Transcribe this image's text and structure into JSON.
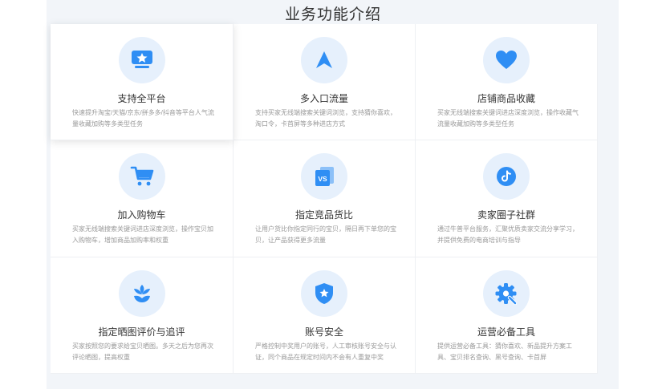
{
  "section": {
    "title": "业务功能介绍"
  },
  "features": [
    {
      "title": "支持全平台",
      "desc": "快速提升淘宝/天猫/京东/拼多多/抖音等平台人气流量收藏加购等多类型任务",
      "icon": "star-screen-icon"
    },
    {
      "title": "多入口流量",
      "desc": "支持买家无线端搜索关键词浏览，支持猜你喜欢，淘口令，卡首屏等多种进店方式",
      "icon": "navigation-arrow-icon"
    },
    {
      "title": "店铺商品收藏",
      "desc": "买家无线端搜索关键词进店深度浏览，操作收藏气流量收藏加购等多类型任务",
      "icon": "heart-icon"
    },
    {
      "title": "加入购物车",
      "desc": "买家无线端搜索关键词进店深度浏览，操作宝贝加入购物车，增加商品加购率和权重",
      "icon": "shopping-cart-icon"
    },
    {
      "title": "指定竞品货比",
      "desc": "让用户货比你指定同行的宝贝，隔日再下单您的宝贝，让产品获得更多流量",
      "icon": "vs-compare-icon"
    },
    {
      "title": "卖家圈子社群",
      "desc": "通过牛普平台服务，汇聚优质卖家交流分享学习，并提供免费的电商培训与指导",
      "icon": "tiktok-icon"
    },
    {
      "title": "指定晒图评价与追评",
      "desc": "买家按照您的要求给宝贝晒图。多天之后为您再次评论晒图，提高权重",
      "icon": "flower-icon"
    },
    {
      "title": "账号安全",
      "desc": "严格控制中奖用户的账号，人工审核账号安全与认证，同个商品在规定时间内不会有人重复中奖",
      "icon": "shield-star-icon"
    },
    {
      "title": "运营必备工具",
      "desc": "提供运营必备工具：猜你喜欢、新品提升方案工具、宝贝排名查询、黑号查询、卡首屏",
      "icon": "gear-wrench-icon"
    }
  ],
  "colors": {
    "accent": "#2f8ef4",
    "icon_bg": "#e6f0fc",
    "band": "#f2f5f9"
  }
}
